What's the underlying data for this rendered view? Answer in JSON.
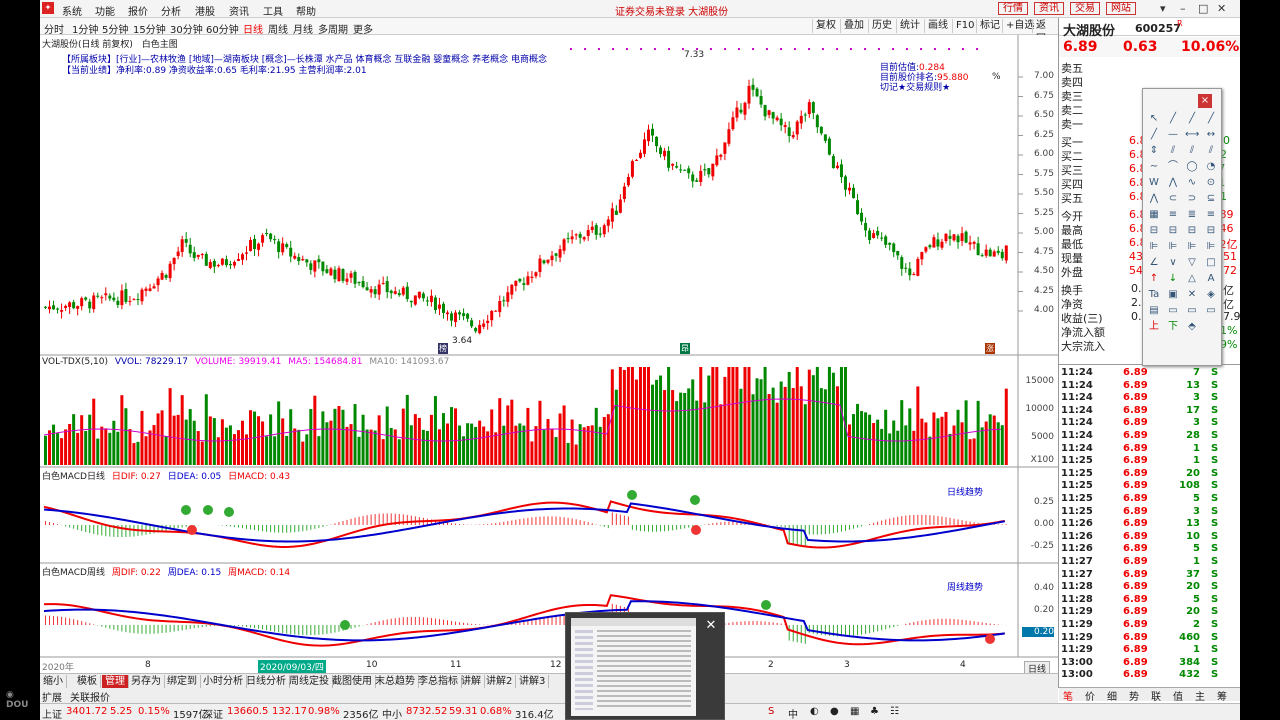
{
  "menu": {
    "items": [
      "系统",
      "功能",
      "报价",
      "分析",
      "港股",
      "资讯",
      "工具",
      "帮助"
    ],
    "title": "证券交易未登录  大湖股份",
    "right_buttons": [
      "行情",
      "资讯",
      "交易",
      "网站"
    ]
  },
  "periods": [
    "分时",
    "1分钟",
    "5分钟",
    "15分钟",
    "30分钟",
    "60分钟",
    "日线",
    "周线",
    "月线",
    "多周期",
    "更多"
  ],
  "active_period": "日线",
  "toolbar": [
    "复权",
    "叠加",
    "历史",
    "统计",
    "画线",
    "F10",
    "标记",
    "+自选",
    "返回"
  ],
  "chart": {
    "header": "大湖股份(日线 前复权)",
    "main_indicator": "白色主图",
    "sector_line": "【所属板块】[行业]—农林牧渔 [地域]—湖南板块 [概念]—长株潭 水产品 体育概念 互联金融 婴童概念 养老概念 电商概念",
    "results_line": "【当前业绩】净利率:0.89 净资收益率:0.65 毛利率:21.95 主营利润率:2.01",
    "valuation_label": "目前估值:",
    "valuation_value": "0.284",
    "score_label": "目前股价排名:",
    "score_value": "95.880",
    "mark_line": "切记★交易规则★",
    "high_label": "7.33",
    "low_label": "3.64",
    "percent_symbol": "%",
    "price_ticks": [
      "7.00",
      "6.75",
      "6.50",
      "6.25",
      "6.00",
      "5.75",
      "5.50",
      "5.25",
      "5.00",
      "4.75",
      "4.50",
      "4.25",
      "4.00"
    ],
    "flag_left": "榜",
    "flag_mid": "昂",
    "flag_right": "涨"
  },
  "volume": {
    "title": "VOL-TDX(5,10)",
    "vvol": "VVOL: 78229.17",
    "volume": "VOLUME: 39919.41",
    "ma5": "MA5: 154684.81",
    "ma10": "MA10: 141093.67",
    "ticks": [
      "15000",
      "10000",
      "5000"
    ],
    "unit": "X100"
  },
  "macd_day": {
    "title": "白色MACD日线",
    "dif": "日DIF: 0.27",
    "dea": "日DEA: 0.05",
    "macd": "日MACD: 0.43",
    "trend": "日线趋势",
    "ticks": [
      "0.25",
      "0.00",
      "-0.25"
    ]
  },
  "macd_week": {
    "title": "白色MACD周线",
    "dif": "周DIF: 0.22",
    "dea": "周DEA: 0.15",
    "macd": "周MACD: 0.14",
    "trend": "周线趋势",
    "ticks": [
      "0.40",
      "0.20",
      "0.00"
    ],
    "current": "0.20"
  },
  "date_axis": {
    "labels": [
      "2020年",
      "8",
      "9",
      "10",
      "11",
      "12",
      "2",
      "3",
      "4"
    ],
    "highlight": "2020/09/03/四"
  },
  "bottom_tabs": [
    "缩小",
    "模板",
    "管理",
    "另存为",
    "绑定到",
    "小时分析",
    "日线分析",
    "周线定投",
    "截图使用",
    "末总趋势",
    "李总指标",
    "讲解",
    "讲解2",
    "讲解3"
  ],
  "bottom_tabs2": [
    "扩展",
    "关联报价"
  ],
  "side_tab": "日线",
  "status": {
    "sh_label": "上证",
    "sh_value": "3401.72",
    "sh_change": "5.25",
    "sh_pct": "0.15%",
    "sh_amount": "1597亿",
    "sz_label": "深证",
    "sz_value": "13660.5",
    "sz_change": "132.17",
    "sz_pct": "0.98%",
    "sz_amount": "2356亿",
    "mid_label": "中小",
    "mid_value": "8732.52",
    "mid_change": "59.31",
    "mid_pct": "0.68%",
    "mid_amount": "316.4亿"
  },
  "quote": {
    "name": "大湖股份",
    "code": "600257",
    "flag": "R",
    "price": "6.89",
    "change": "0.63",
    "pct": "10.06%",
    "sell_labels": [
      "卖五",
      "卖四",
      "卖三",
      "卖二",
      "卖一"
    ],
    "buy_labels": [
      "买一",
      "买二",
      "买三",
      "买四",
      "买五"
    ],
    "buy_values": [
      {
        "price": "6.8",
        "vol": "250"
      },
      {
        "price": "6.8",
        "vol": "-42"
      },
      {
        "price": "6.8",
        "vol": "+7"
      },
      {
        "price": "6.8",
        "vol": "+1"
      },
      {
        "price": "6.8",
        "vol": "-31"
      }
    ],
    "stats": [
      {
        "label": "今开",
        "v1": "6.8",
        "v2": "6.89"
      },
      {
        "label": "最高",
        "v1": "6.8",
        "v2": "0.46"
      },
      {
        "label": "最低",
        "v1": "6.8",
        "v2": "3.2亿"
      },
      {
        "label": "现量",
        "v1": "43",
        "v2": "0351"
      },
      {
        "label": "外盘",
        "v1": "547",
        "v2": "4872"
      }
    ],
    "stats2": [
      {
        "label": "换手",
        "v1": "0.84",
        "v2": "81亿"
      },
      {
        "label": "净资",
        "v1": "2.4",
        "v2": "81亿"
      },
      {
        "label": "收益(三)",
        "v1": "0.01",
        "v2": "437.9"
      }
    ],
    "flow": [
      {
        "label": "净流入额",
        "v": "-71%"
      },
      {
        "label": "大宗流入",
        "v": "-19%"
      }
    ]
  },
  "ticks": [
    {
      "t": "11:24",
      "p": "6.89",
      "v": "7",
      "s": "S"
    },
    {
      "t": "11:24",
      "p": "6.89",
      "v": "13",
      "s": "S"
    },
    {
      "t": "11:24",
      "p": "6.89",
      "v": "3",
      "s": "S"
    },
    {
      "t": "11:24",
      "p": "6.89",
      "v": "17",
      "s": "S"
    },
    {
      "t": "11:24",
      "p": "6.89",
      "v": "3",
      "s": "S"
    },
    {
      "t": "11:24",
      "p": "6.89",
      "v": "28",
      "s": "S"
    },
    {
      "t": "11:24",
      "p": "6.89",
      "v": "1",
      "s": "S"
    },
    {
      "t": "11:25",
      "p": "6.89",
      "v": "1",
      "s": "S"
    },
    {
      "t": "11:25",
      "p": "6.89",
      "v": "20",
      "s": "S"
    },
    {
      "t": "11:25",
      "p": "6.89",
      "v": "108",
      "s": "S"
    },
    {
      "t": "11:25",
      "p": "6.89",
      "v": "5",
      "s": "S"
    },
    {
      "t": "11:25",
      "p": "6.89",
      "v": "3",
      "s": "S"
    },
    {
      "t": "11:26",
      "p": "6.89",
      "v": "13",
      "s": "S"
    },
    {
      "t": "11:26",
      "p": "6.89",
      "v": "10",
      "s": "S"
    },
    {
      "t": "11:26",
      "p": "6.89",
      "v": "5",
      "s": "S"
    },
    {
      "t": "11:27",
      "p": "6.89",
      "v": "1",
      "s": "S"
    },
    {
      "t": "11:27",
      "p": "6.89",
      "v": "37",
      "s": "S"
    },
    {
      "t": "11:28",
      "p": "6.89",
      "v": "20",
      "s": "S"
    },
    {
      "t": "11:28",
      "p": "6.89",
      "v": "5",
      "s": "S"
    },
    {
      "t": "11:29",
      "p": "6.89",
      "v": "20",
      "s": "S"
    },
    {
      "t": "11:29",
      "p": "6.89",
      "v": "2",
      "s": "S"
    },
    {
      "t": "11:29",
      "p": "6.89",
      "v": "460",
      "s": "S"
    },
    {
      "t": "11:29",
      "p": "6.89",
      "v": "1",
      "s": "S"
    },
    {
      "t": "13:00",
      "p": "6.89",
      "v": "384",
      "s": "S"
    },
    {
      "t": "13:00",
      "p": "6.89",
      "v": "432",
      "s": "S"
    }
  ],
  "right_bottom_tabs": [
    "笔",
    "价",
    "细",
    "势",
    "联",
    "值",
    "主",
    "筹"
  ],
  "tool_close": "×"
}
